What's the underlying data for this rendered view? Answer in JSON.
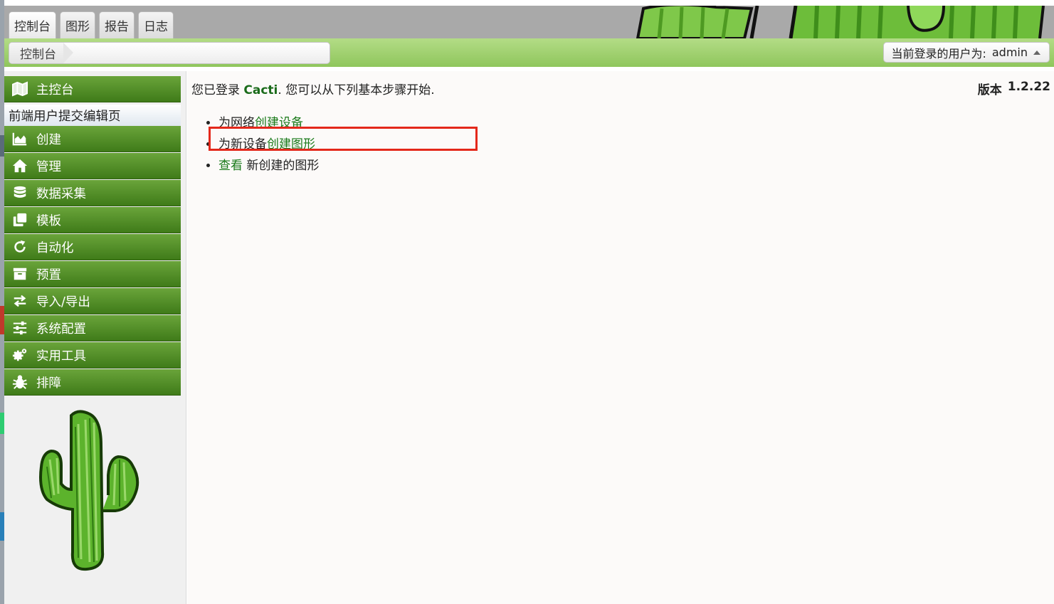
{
  "tabs": [
    {
      "label": "控制台",
      "active": true
    },
    {
      "label": "图形",
      "active": false
    },
    {
      "label": "报告",
      "active": false
    },
    {
      "label": "日志",
      "active": false
    }
  ],
  "breadcrumb": {
    "current": "控制台"
  },
  "user": {
    "prefix": "当前登录的用户为:",
    "name": "admin",
    "icon": "caret-up-icon"
  },
  "sidebar": {
    "items": [
      {
        "label": "主控台",
        "icon": "map-icon"
      },
      {
        "label": "创建",
        "icon": "area-chart-icon"
      },
      {
        "label": "管理",
        "icon": "home-icon"
      },
      {
        "label": "数据采集",
        "icon": "database-icon"
      },
      {
        "label": "模板",
        "icon": "clone-icon"
      },
      {
        "label": "自动化",
        "icon": "refresh-icon"
      },
      {
        "label": "预置",
        "icon": "archive-icon"
      },
      {
        "label": "导入/导出",
        "icon": "exchange-icon"
      },
      {
        "label": "系统配置",
        "icon": "sliders-icon"
      },
      {
        "label": "实用工具",
        "icon": "cogs-icon"
      },
      {
        "label": "排障",
        "icon": "bug-icon"
      }
    ],
    "submenu_label": "前端用户提交编辑页"
  },
  "main": {
    "welcome_prefix": "您已登录",
    "welcome_brand": "Cacti",
    "welcome_suffix": ". 您可以从下列基本步骤开始.",
    "version_label": "版本",
    "version_number": "1.2.22",
    "steps": [
      {
        "pre": "为网络",
        "link": "创建设备",
        "post": ""
      },
      {
        "pre": "为新设备",
        "link": "创建图形",
        "post": ""
      },
      {
        "pre": "",
        "link": "查看",
        "post": " 新创建的图形"
      }
    ]
  },
  "colors": {
    "menu_green": "#4d8a24",
    "nav_green": "#9fd16f",
    "link_green": "#1a7a1a",
    "highlight_red": "#e4281b"
  }
}
